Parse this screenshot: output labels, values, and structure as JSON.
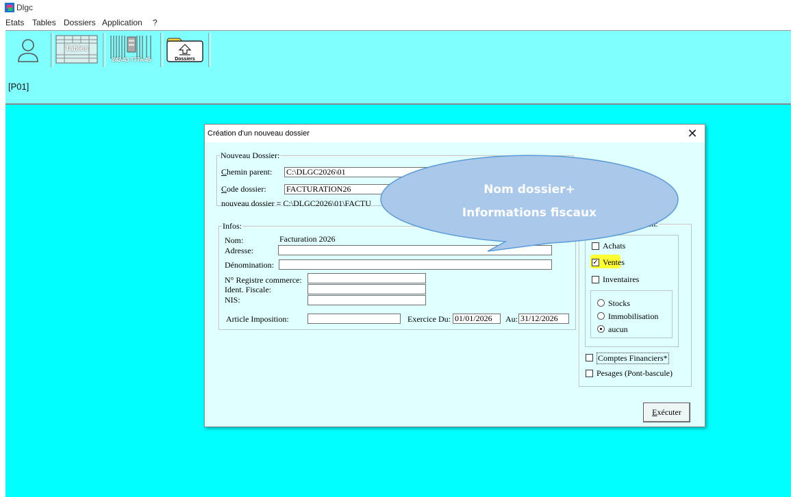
{
  "app": {
    "title": "Dlgc"
  },
  "menu": [
    "Etats",
    "Tables",
    "Dossiers",
    "Application",
    "?"
  ],
  "toolbar": {
    "tables_label": "Tables",
    "report_label": "242-43 T77a-45",
    "dossiers_label": "Dossiers"
  },
  "breadcrumb": "[P01]",
  "dialog": {
    "title": "Création d'un nouveau dossier",
    "close": "✕",
    "nouveau": {
      "legend": "Nouveau Dossier:",
      "chemin_label_u": "C",
      "chemin_label_rest": "hemin parent:",
      "chemin_value": "C:\\DLGC2026\\01",
      "code_label_u": "C",
      "code_label_rest": "ode dossier:",
      "code_value": "FACTURATION26",
      "path_text": "nouveau dossier = C:\\DLGC2026\\01\\FACTU"
    },
    "infos": {
      "legend": "Infos:",
      "nom_label": "Nom:",
      "nom_value": "Facturation 2026",
      "adresse_label": "Adresse:",
      "adresse_value": "",
      "denomination_label": "Dénomination:",
      "denomination_value": "",
      "registre_label": "N° Registre commerce:",
      "registre_value": "",
      "ident_label": "Ident. Fiscale:",
      "ident_value": "",
      "nis_label": "NIS:",
      "nis_value": "",
      "article_label": "Article Imposition:",
      "article_value": "",
      "exercice_label": "Exercice Du:",
      "exercice_du": "01/01/2026",
      "au_label": "Au:",
      "exercice_au": "31/12/2026"
    },
    "gestion": {
      "legend_visible": "ion:",
      "checks": [
        {
          "label": "Achats",
          "checked": false
        },
        {
          "label": "Ventes",
          "checked": true
        },
        {
          "label": "Inventaires",
          "checked": false
        }
      ],
      "radios": [
        {
          "label": "Stocks",
          "selected": false
        },
        {
          "label": "Immobilisation",
          "selected": false
        },
        {
          "label": "aucun",
          "selected": true
        }
      ],
      "comptes_label": "Comptes Financiers*",
      "pesages_label": "Pesages (Pont-bascule)"
    },
    "execute_u": "E",
    "execute_rest": "xécuter",
    "check_mark": "✓"
  },
  "callout": {
    "line1": "Nom dossier+",
    "line2": "Informations fiscaux"
  },
  "colors": {
    "workspace": "#00ffff",
    "toolbar": "#80ffff",
    "dialog_bg": "#e0ffff",
    "callout_fill": "#a9c8ea",
    "callout_stroke": "#5b9bd5",
    "highlight": "#ffff33"
  }
}
